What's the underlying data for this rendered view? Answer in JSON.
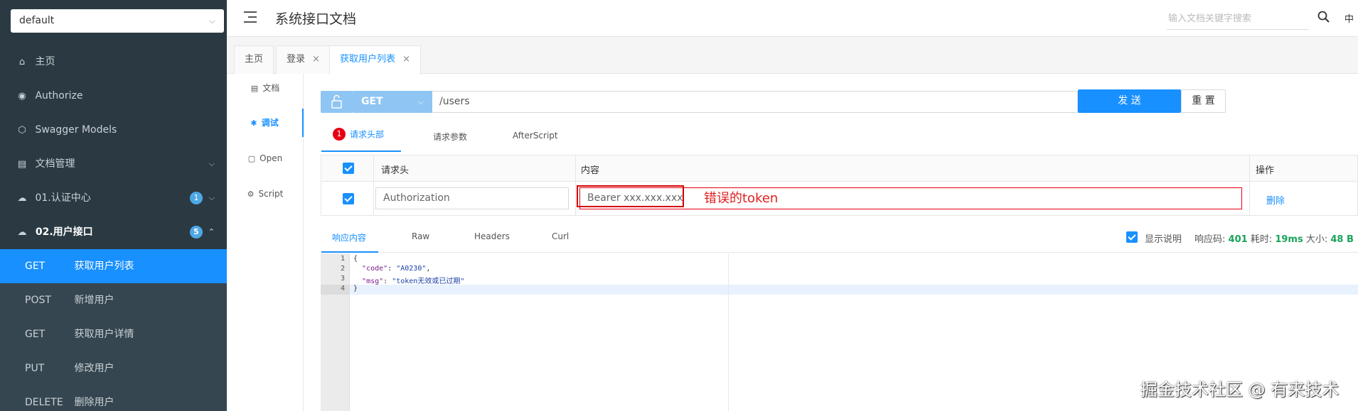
{
  "sidebar": {
    "group": "default",
    "items": [
      {
        "icon": "home-icon",
        "glyph": "⌂",
        "label": "主页"
      },
      {
        "icon": "lock-icon",
        "glyph": "🔒",
        "label": "Authorize"
      },
      {
        "icon": "cube-icon",
        "glyph": "⬡",
        "label": "Swagger Models"
      },
      {
        "icon": "doc-manage-icon",
        "glyph": "▤",
        "label": "文档管理"
      },
      {
        "icon": "cloud-icon",
        "glyph": "☁",
        "label": "01.认证中心",
        "badge": "1"
      },
      {
        "icon": "cloud-icon",
        "glyph": "☁",
        "label": "02.用户接口",
        "badge": "5"
      }
    ],
    "sub_items": [
      {
        "method": "GET",
        "label": "获取用户列表"
      },
      {
        "method": "POST",
        "label": "新增用户"
      },
      {
        "method": "GET",
        "label": "获取用户详情"
      },
      {
        "method": "PUT",
        "label": "修改用户"
      },
      {
        "method": "DELETE",
        "label": "删除用户"
      }
    ]
  },
  "header": {
    "title": "系统接口文档",
    "search_placeholder": "输入文档关键字搜索",
    "lang": "中"
  },
  "tabs": [
    {
      "label": "主页"
    },
    {
      "label": "登录",
      "close": "×"
    },
    {
      "label": "获取用户列表",
      "close": "×"
    }
  ],
  "inner_nav": [
    {
      "label": "文档",
      "glyph": "▤"
    },
    {
      "label": "调试",
      "glyph": "✱"
    },
    {
      "label": "Open",
      "glyph": "▢"
    },
    {
      "label": "Script",
      "glyph": "⚙"
    }
  ],
  "request": {
    "method": "GET",
    "url": "/users",
    "send": "发 送",
    "reset": "重 置"
  },
  "sub_tabs": {
    "error_count": "1",
    "headers": "请求头部",
    "params": "请求参数",
    "after_script": "AfterScript"
  },
  "header_table": {
    "col_header": "请求头",
    "col_content": "内容",
    "col_action": "操作",
    "row_key": "Authorization",
    "row_value": "Bearer xxx.xxx.xxx",
    "delete": "删除"
  },
  "annotation": "错误的token",
  "response_tabs": {
    "content": "响应内容",
    "raw": "Raw",
    "headers": "Headers",
    "curl": "Curl"
  },
  "response_meta": {
    "show_desc": "显示说明",
    "code_label": "响应码:",
    "code": "401",
    "time_label": "耗时:",
    "time": "19ms",
    "size_label": "大小:",
    "size": "48 B"
  },
  "code_lines": [
    "1",
    "2",
    "3",
    "4"
  ],
  "json": {
    "code_key": "\"code\"",
    "code_val": "\"A0230\"",
    "msg_key": "\"msg\"",
    "msg_val": "\"token无效或已过期\""
  },
  "watermark": "掘金技术社区 @ 有来技术",
  "colors": {
    "accent": "#1890ff",
    "sidebar": "#2b3a42",
    "error": "#e60012",
    "success": "#19a35a"
  }
}
